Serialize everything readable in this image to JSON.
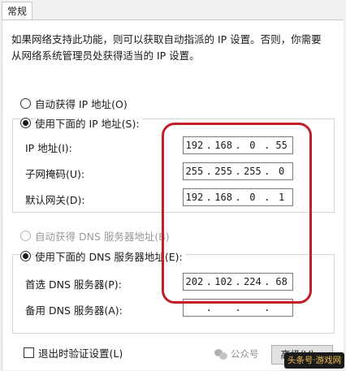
{
  "tab": {
    "label": "常规"
  },
  "description": "如果网络支持此功能，则可以获取自动指派的 IP 设置。否则，你需要从网络系统管理员处获得适当的 IP 设置。",
  "ip_section": {
    "auto_label": "自动获得 IP 地址(O)",
    "manual_label": "使用下面的 IP 地址(S):",
    "selected": "manual",
    "fields": [
      {
        "label": "IP 地址(I):",
        "octets": [
          "192",
          "168",
          "0",
          "55"
        ]
      },
      {
        "label": "子网掩码(U):",
        "octets": [
          "255",
          "255",
          "255",
          "0"
        ]
      },
      {
        "label": "默认网关(D):",
        "octets": [
          "192",
          "168",
          "0",
          "1"
        ]
      }
    ]
  },
  "dns_section": {
    "auto_label": "自动获得 DNS 服务器地址(B)",
    "manual_label": "使用下面的 DNS 服务器地址(E):",
    "selected": "manual",
    "fields": [
      {
        "label": "首选 DNS 服务器(P):",
        "octets": [
          "202",
          "102",
          "224",
          "68"
        ]
      },
      {
        "label": "备用 DNS 服务器(A):",
        "octets": [
          "",
          "",
          "",
          ""
        ]
      }
    ]
  },
  "validate_label": "退出时验证设置(L)",
  "advanced_button": "高级(V)...",
  "watermark": {
    "text": "公众号",
    "brand": "头条号·游戏网"
  },
  "colors": {
    "highlight": "#c21f2a"
  }
}
